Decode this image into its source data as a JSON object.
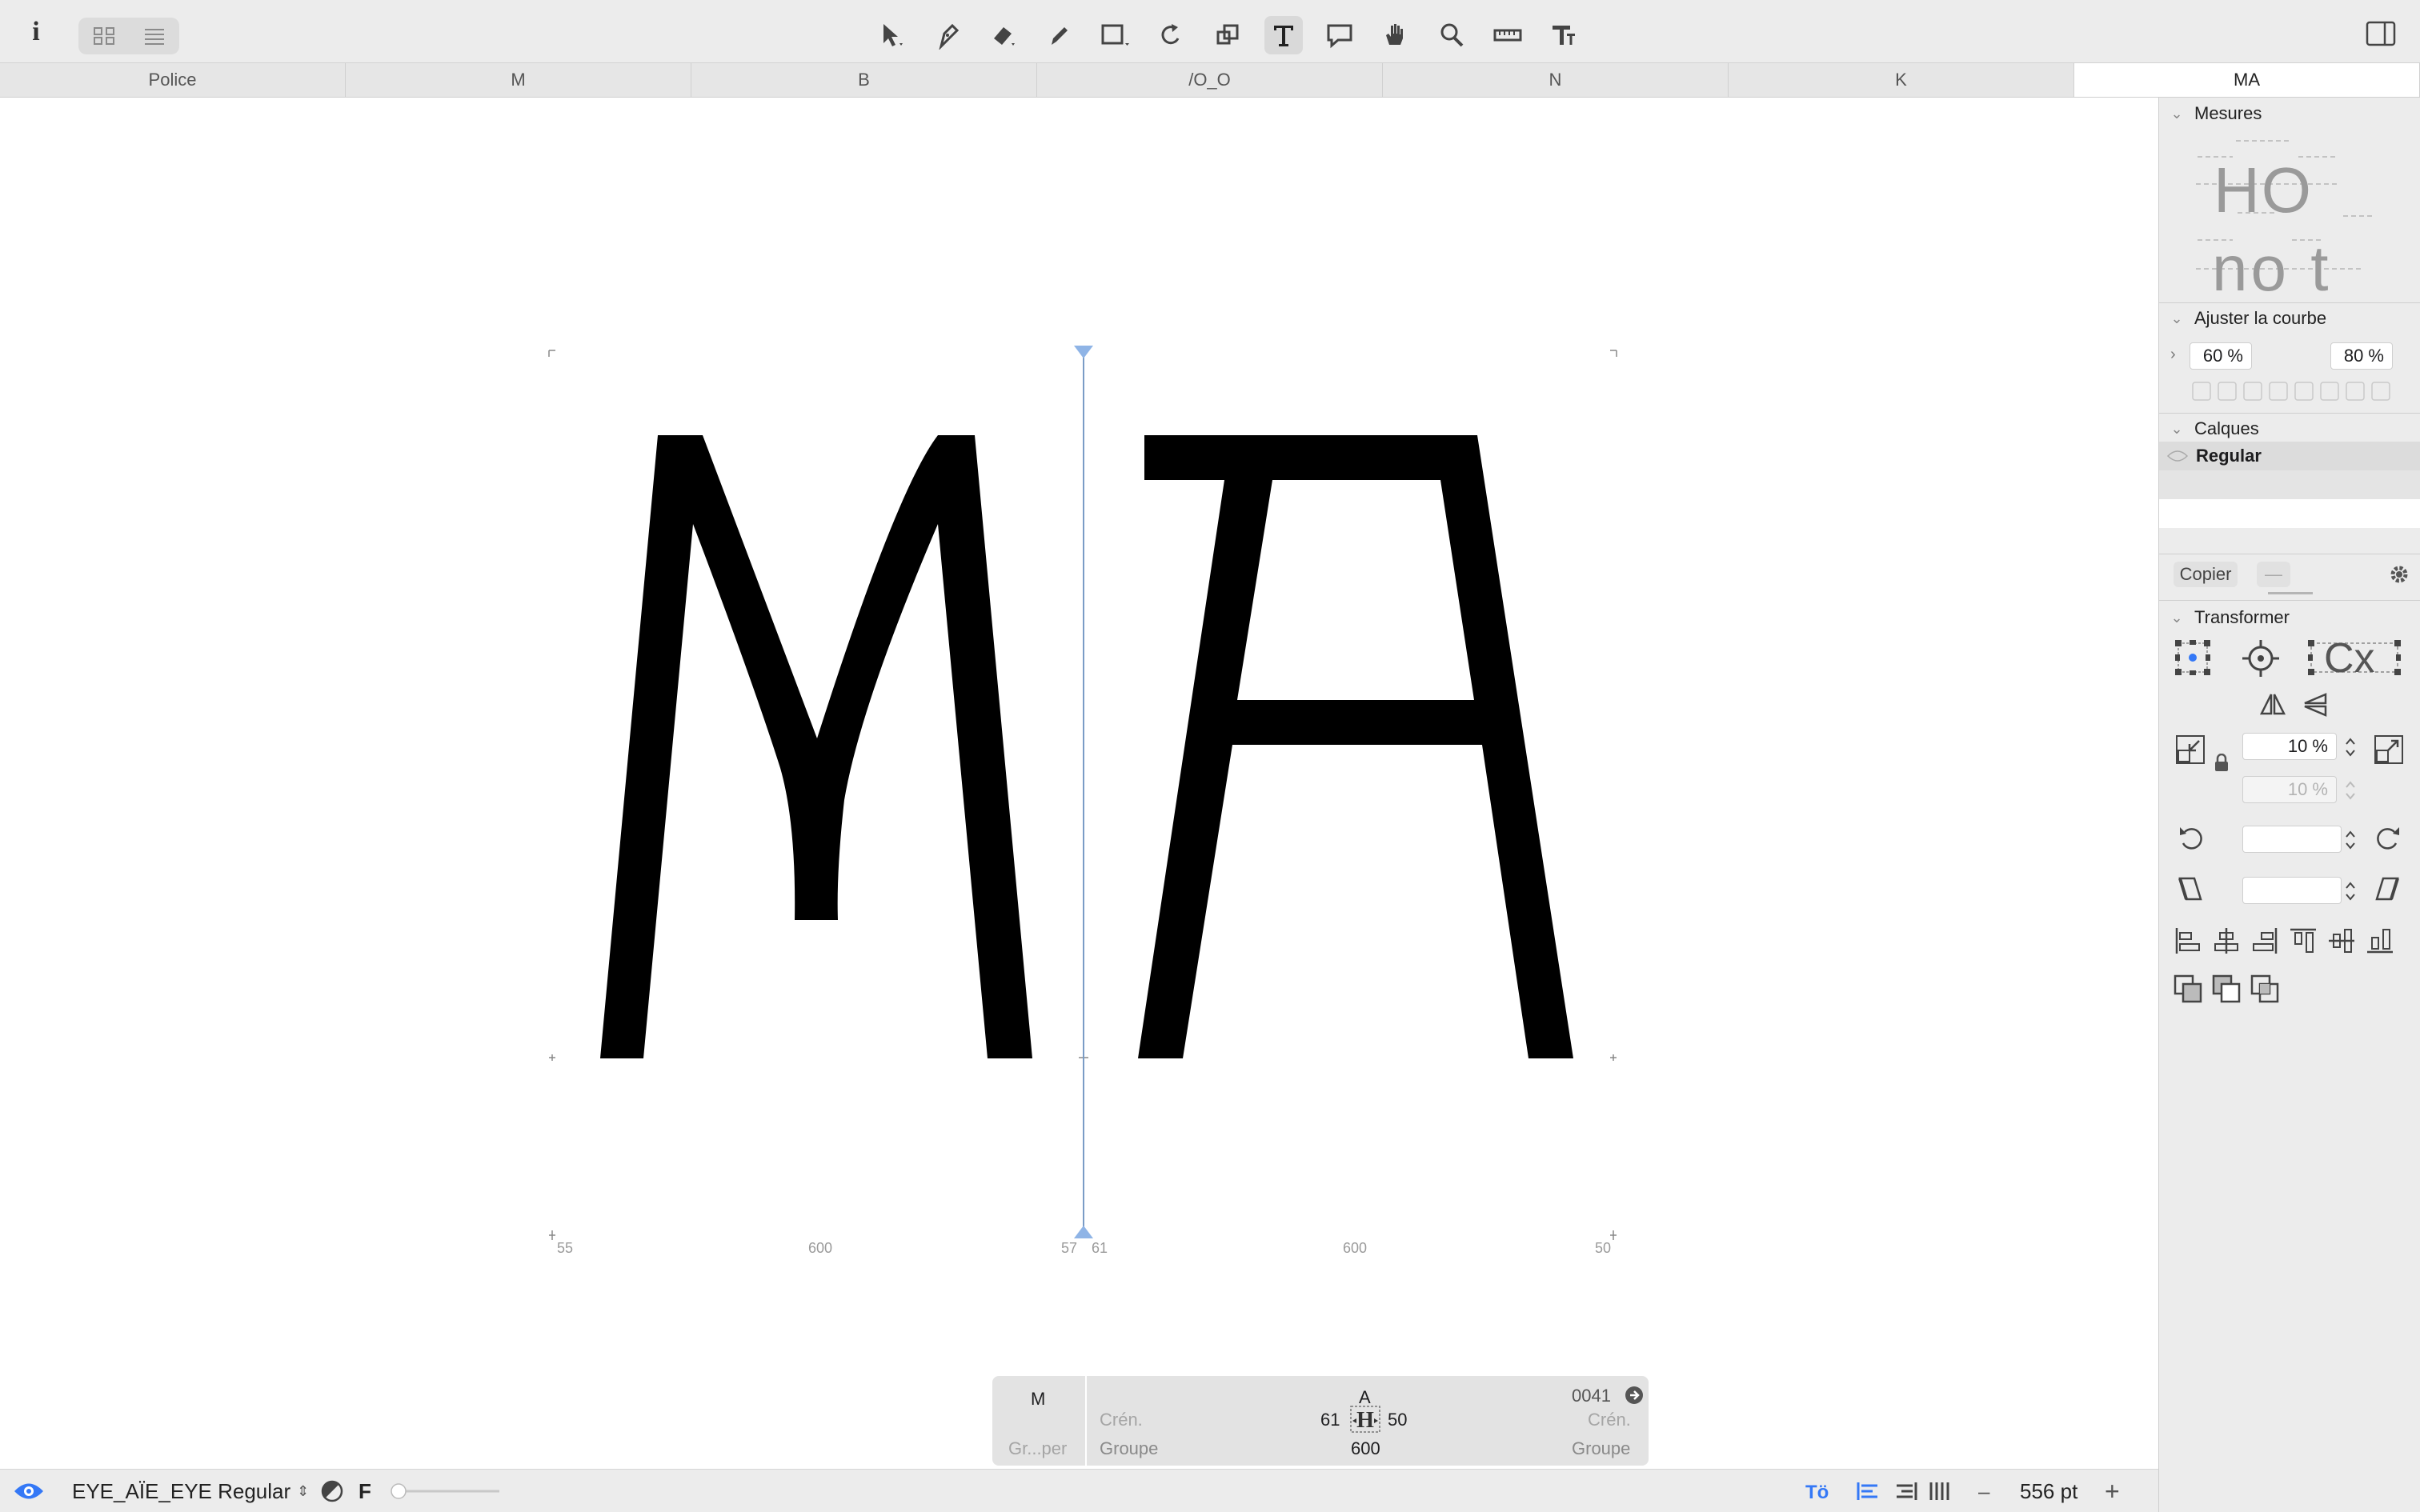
{
  "toolbar": {
    "info_icon": "info-icon",
    "view_toggle": [
      "grid-view-icon",
      "list-view-icon"
    ],
    "tools": [
      "select-tool-icon",
      "pen-tool-icon",
      "eraser-tool-icon",
      "pencil-tool-icon",
      "rectangle-tool-icon",
      "rotate-tool-icon",
      "scale-tool-icon",
      "text-tool-icon",
      "annotation-tool-icon",
      "hand-tool-icon",
      "zoom-tool-icon",
      "measure-tool-icon",
      "text-metrics-tool-icon"
    ],
    "active_tool": "text-tool-icon",
    "sidebar_toggle": "sidebar-toggle-icon"
  },
  "tabs": [
    {
      "label": "Police",
      "active": false
    },
    {
      "label": "M",
      "active": false
    },
    {
      "label": "B",
      "active": false
    },
    {
      "label": "/O_O",
      "active": false
    },
    {
      "label": "N",
      "active": false
    },
    {
      "label": "K",
      "active": false
    },
    {
      "label": "MA",
      "active": true
    }
  ],
  "canvas": {
    "glyph_M": {
      "lsb": "55",
      "width": "600",
      "rsb": "57"
    },
    "glyph_A": {
      "lsb": "61",
      "width": "600",
      "rsb": "50"
    }
  },
  "infobox": {
    "left_glyph": "M",
    "left_group": "Gr...per",
    "glyph": "A",
    "unicode": "0041",
    "kern_left_label": "Crén.",
    "kern_right_label": "Crén.",
    "group_left_label": "Groupe",
    "group_right_label": "Groupe",
    "lsb": "61",
    "rsb": "50",
    "width": "600"
  },
  "statusbar": {
    "font_name": "EYE_AÏE_EYE Regular",
    "f_label": "F",
    "size": "556 pt",
    "minus": "–",
    "plus": "+"
  },
  "panel": {
    "mesures_title": "Mesures",
    "mesures_preview_1": "HO",
    "mesures_preview_2": "no t",
    "ajuster_title": "Ajuster la courbe",
    "curve_left": "60 %",
    "curve_right": "80 %",
    "calques_title": "Calques",
    "layer_name": "Regular",
    "copy_button": "Copier",
    "copy_dash": "—",
    "transform_title": "Transformer",
    "scale_x": "10 %",
    "scale_y": "10 %",
    "rotate_value": "",
    "slant_value": "",
    "cx_label": "Cx"
  },
  "colors": {
    "accent": "#3478f6",
    "guide": "#7a9cc6",
    "toolbar_bg": "#ececec",
    "panel_bg": "#ececec"
  }
}
